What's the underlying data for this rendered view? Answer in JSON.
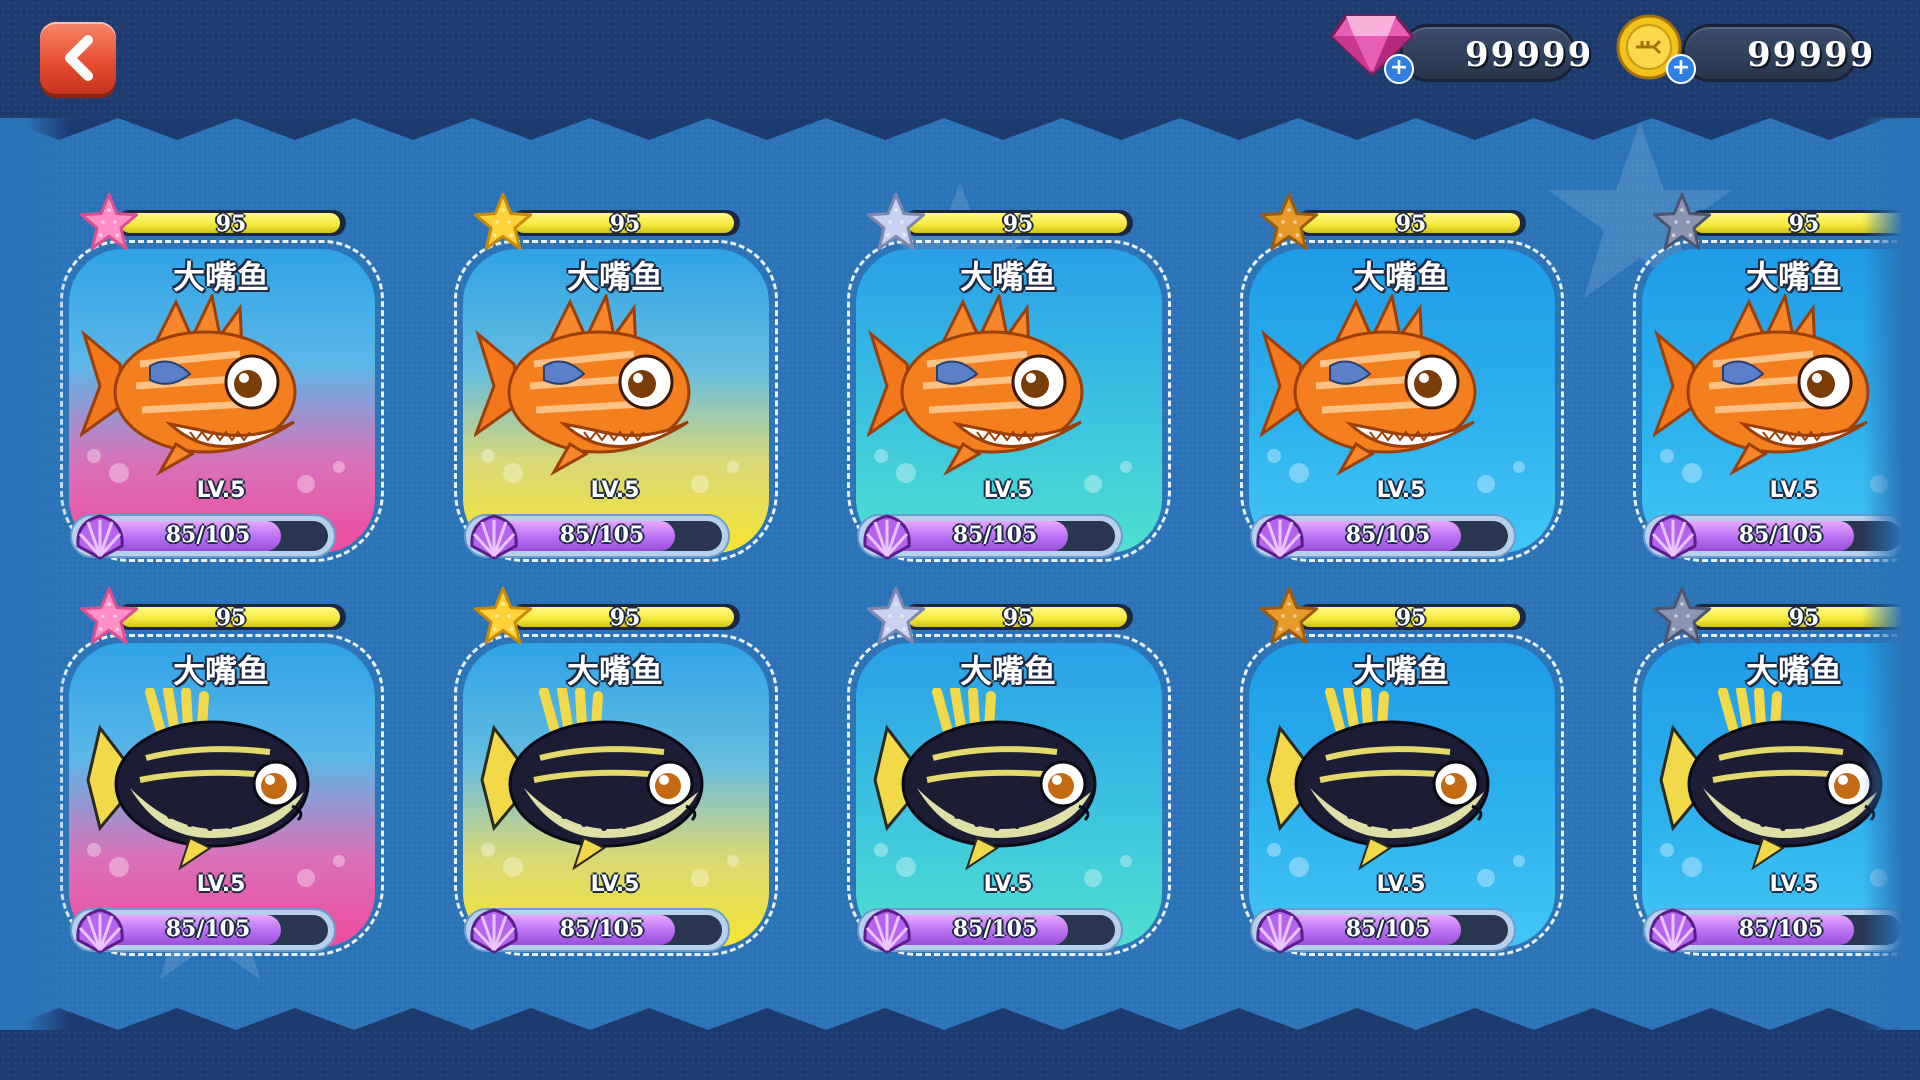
{
  "header": {
    "back_icon": "chevron-left-icon",
    "gems": {
      "icon": "gem-icon",
      "value": "99999"
    },
    "coins": {
      "icon": "coin-icon",
      "value": "99999"
    }
  },
  "colors": {
    "board": "#2a73b7",
    "band": "#1e3b70",
    "score_bar": "#f4e83a",
    "exp_bar": "#b46af0"
  },
  "cards": [
    {
      "name": "大嘴鱼",
      "score": "95",
      "level": "LV.5",
      "exp": "85/105",
      "exp_ratio": 0.81,
      "rank_star": "pink",
      "bg": "pink",
      "fish": "orange-striped-fish"
    },
    {
      "name": "大嘴鱼",
      "score": "95",
      "level": "LV.5",
      "exp": "85/105",
      "exp_ratio": 0.81,
      "rank_star": "gold",
      "bg": "yellow",
      "fish": "orange-striped-fish"
    },
    {
      "name": "大嘴鱼",
      "score": "95",
      "level": "LV.5",
      "exp": "85/105",
      "exp_ratio": 0.81,
      "rank_star": "silver",
      "bg": "cyan",
      "fish": "orange-striped-fish"
    },
    {
      "name": "大嘴鱼",
      "score": "95",
      "level": "LV.5",
      "exp": "85/105",
      "exp_ratio": 0.81,
      "rank_star": "bronze",
      "bg": "blue",
      "fish": "orange-striped-fish"
    },
    {
      "name": "大嘴鱼",
      "score": "95",
      "level": "LV.5",
      "exp": "85/105",
      "exp_ratio": 0.81,
      "rank_star": "gray",
      "bg": "blue2",
      "fish": "orange-striped-fish"
    },
    {
      "name": "大嘴鱼",
      "score": "95",
      "level": "LV.5",
      "exp": "85/105",
      "exp_ratio": 0.81,
      "rank_star": "pink",
      "bg": "pink",
      "fish": "dark-puffer-fish"
    },
    {
      "name": "大嘴鱼",
      "score": "95",
      "level": "LV.5",
      "exp": "85/105",
      "exp_ratio": 0.81,
      "rank_star": "gold",
      "bg": "yellow",
      "fish": "dark-puffer-fish"
    },
    {
      "name": "大嘴鱼",
      "score": "95",
      "level": "LV.5",
      "exp": "85/105",
      "exp_ratio": 0.81,
      "rank_star": "silver",
      "bg": "cyan",
      "fish": "dark-puffer-fish"
    },
    {
      "name": "大嘴鱼",
      "score": "95",
      "level": "LV.5",
      "exp": "85/105",
      "exp_ratio": 0.81,
      "rank_star": "bronze",
      "bg": "blue",
      "fish": "dark-puffer-fish"
    },
    {
      "name": "大嘴鱼",
      "score": "95",
      "level": "LV.5",
      "exp": "85/105",
      "exp_ratio": 0.81,
      "rank_star": "gray",
      "bg": "blue2",
      "fish": "dark-puffer-fish"
    }
  ]
}
